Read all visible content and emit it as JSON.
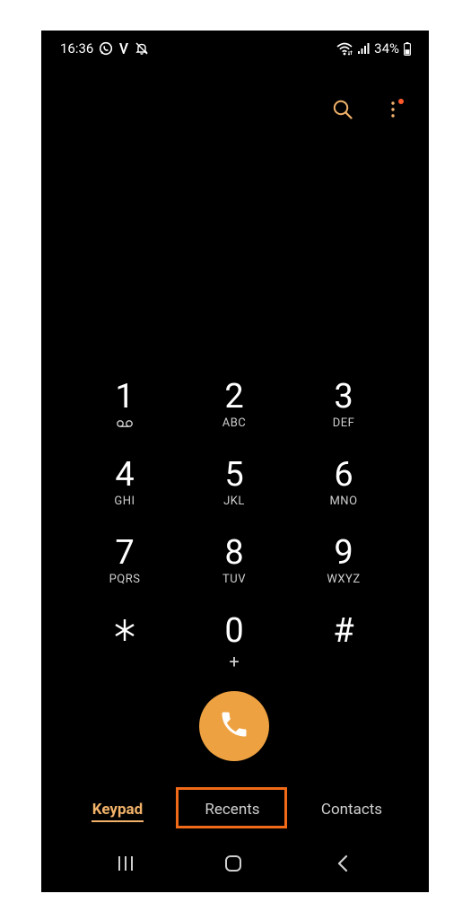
{
  "status_bar": {
    "time": "16:36",
    "battery": "34%"
  },
  "keypad": {
    "keys": [
      {
        "digit": "1",
        "letters": ""
      },
      {
        "digit": "2",
        "letters": "ABC"
      },
      {
        "digit": "3",
        "letters": "DEF"
      },
      {
        "digit": "4",
        "letters": "GHI"
      },
      {
        "digit": "5",
        "letters": "JKL"
      },
      {
        "digit": "6",
        "letters": "MNO"
      },
      {
        "digit": "7",
        "letters": "PQRS"
      },
      {
        "digit": "8",
        "letters": "TUV"
      },
      {
        "digit": "9",
        "letters": "WXYZ"
      },
      {
        "digit": "*",
        "letters": ""
      },
      {
        "digit": "0",
        "letters": "+"
      },
      {
        "digit": "#",
        "letters": ""
      }
    ]
  },
  "tabs": {
    "keypad": "Keypad",
    "recents": "Recents",
    "contacts": "Contacts"
  },
  "colors": {
    "accent": "#eea141",
    "tab_active": "#f2b26a",
    "highlight": "#f06a18",
    "notify": "#ff5a2b"
  }
}
